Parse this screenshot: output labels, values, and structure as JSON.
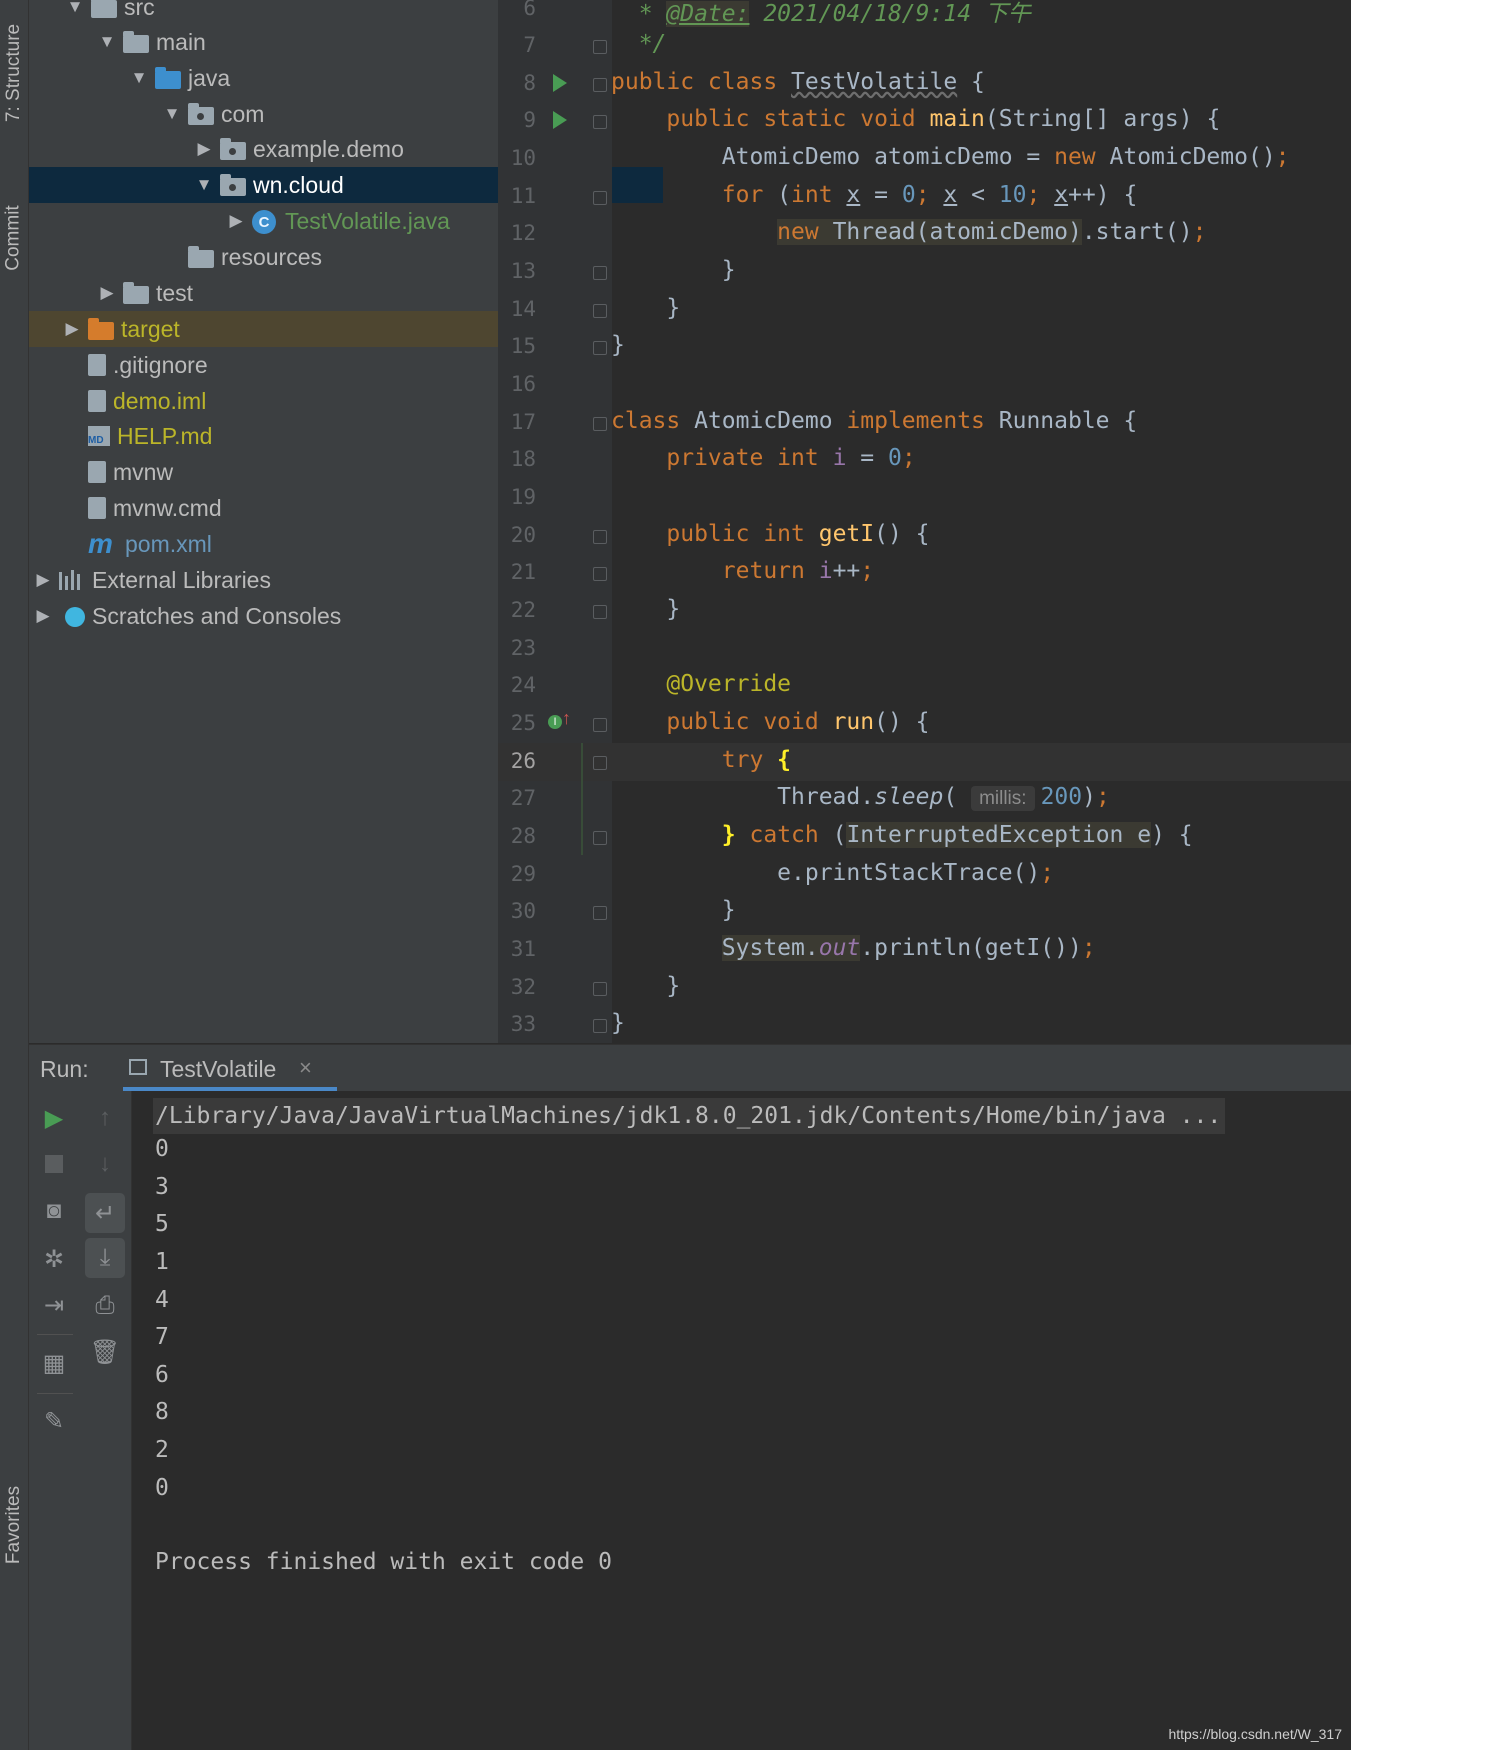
{
  "tool_strip": {
    "structure": "7: Structure",
    "commit": "Commit",
    "favorites": "Favorites"
  },
  "project_tree": {
    "items": [
      {
        "label": "src"
      },
      {
        "label": "main"
      },
      {
        "label": "java"
      },
      {
        "label": "com"
      },
      {
        "label": "example.demo"
      },
      {
        "label": "wn.cloud"
      },
      {
        "label": "TestVolatile.java"
      },
      {
        "label": "resources"
      },
      {
        "label": "test"
      },
      {
        "label": "target"
      },
      {
        "label": ".gitignore"
      },
      {
        "label": "demo.iml"
      },
      {
        "label": "HELP.md"
      },
      {
        "label": "mvnw"
      },
      {
        "label": "mvnw.cmd"
      },
      {
        "label": "pom.xml"
      },
      {
        "label": "External Libraries"
      },
      {
        "label": "Scratches and Consoles"
      }
    ]
  },
  "editor": {
    "line_numbers": [
      "6",
      "7",
      "8",
      "9",
      "10",
      "11",
      "12",
      "13",
      "14",
      "15",
      "16",
      "17",
      "18",
      "19",
      "20",
      "21",
      "22",
      "23",
      "24",
      "25",
      "26",
      "27",
      "28",
      "29",
      "30",
      "31",
      "32",
      "33"
    ],
    "current_line": "26",
    "param_hint": "millis:"
  },
  "run_panel": {
    "label": "Run:",
    "tab_title": "TestVolatile",
    "tab_close": "×",
    "command": "/Library/Java/JavaVirtualMachines/jdk1.8.0_201.jdk/Contents/Home/bin/java ...",
    "output": [
      "0",
      "3",
      "5",
      "1",
      "4",
      "7",
      "6",
      "8",
      "2",
      "0"
    ],
    "exit_message": "Process finished with exit code 0"
  },
  "watermark": "https://blog.csdn.net/W_317"
}
